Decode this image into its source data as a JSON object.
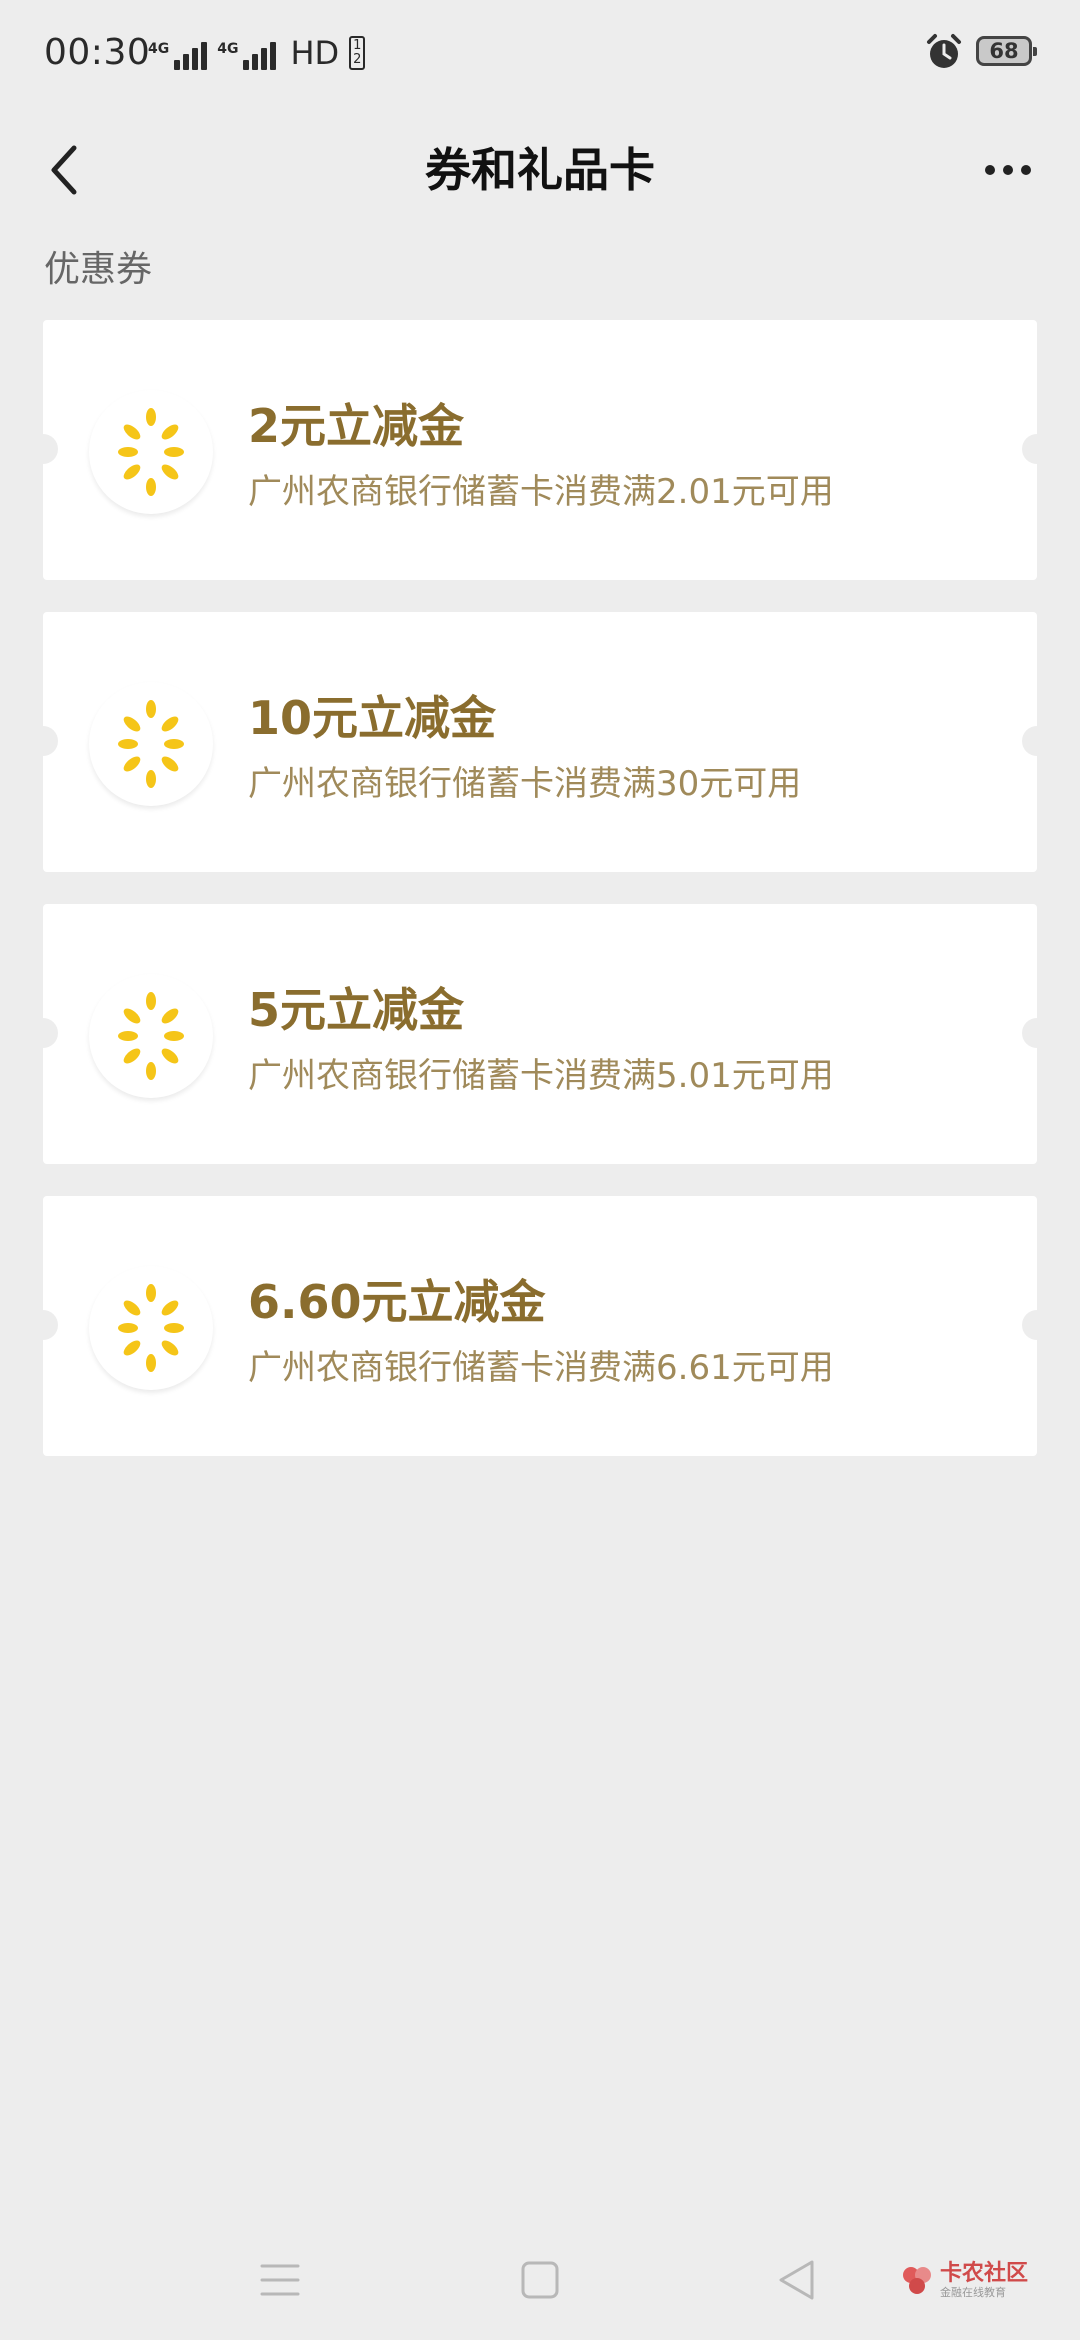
{
  "status_bar": {
    "time": "00:30",
    "net1_tag": "4G",
    "net2_tag": "4G",
    "hd_label": "HD",
    "sim_top": "1",
    "sim_bottom": "2",
    "battery_level": "68"
  },
  "nav": {
    "title": "券和礼品卡",
    "back_icon": "chevron-left-icon",
    "more_icon": "more-dots-icon"
  },
  "section": {
    "title": "优惠券"
  },
  "coupons": [
    {
      "title": "2元立减金",
      "desc": "广州农商银行储蓄卡消费满2.01元可用"
    },
    {
      "title": "10元立减金",
      "desc": "广州农商银行储蓄卡消费满30元可用"
    },
    {
      "title": "5元立减金",
      "desc": "广州农商银行储蓄卡消费满5.01元可用"
    },
    {
      "title": "6.60元立减金",
      "desc": "广州农商银行储蓄卡消费满6.61元可用"
    }
  ],
  "colors": {
    "background": "#ededed",
    "card": "#ffffff",
    "coupon_title": "#8a6d2e",
    "coupon_desc": "#a08a5a",
    "logo_yellow": "#f5c518"
  },
  "watermark": {
    "main": "卡农社区",
    "sub": "金融在线教育"
  }
}
